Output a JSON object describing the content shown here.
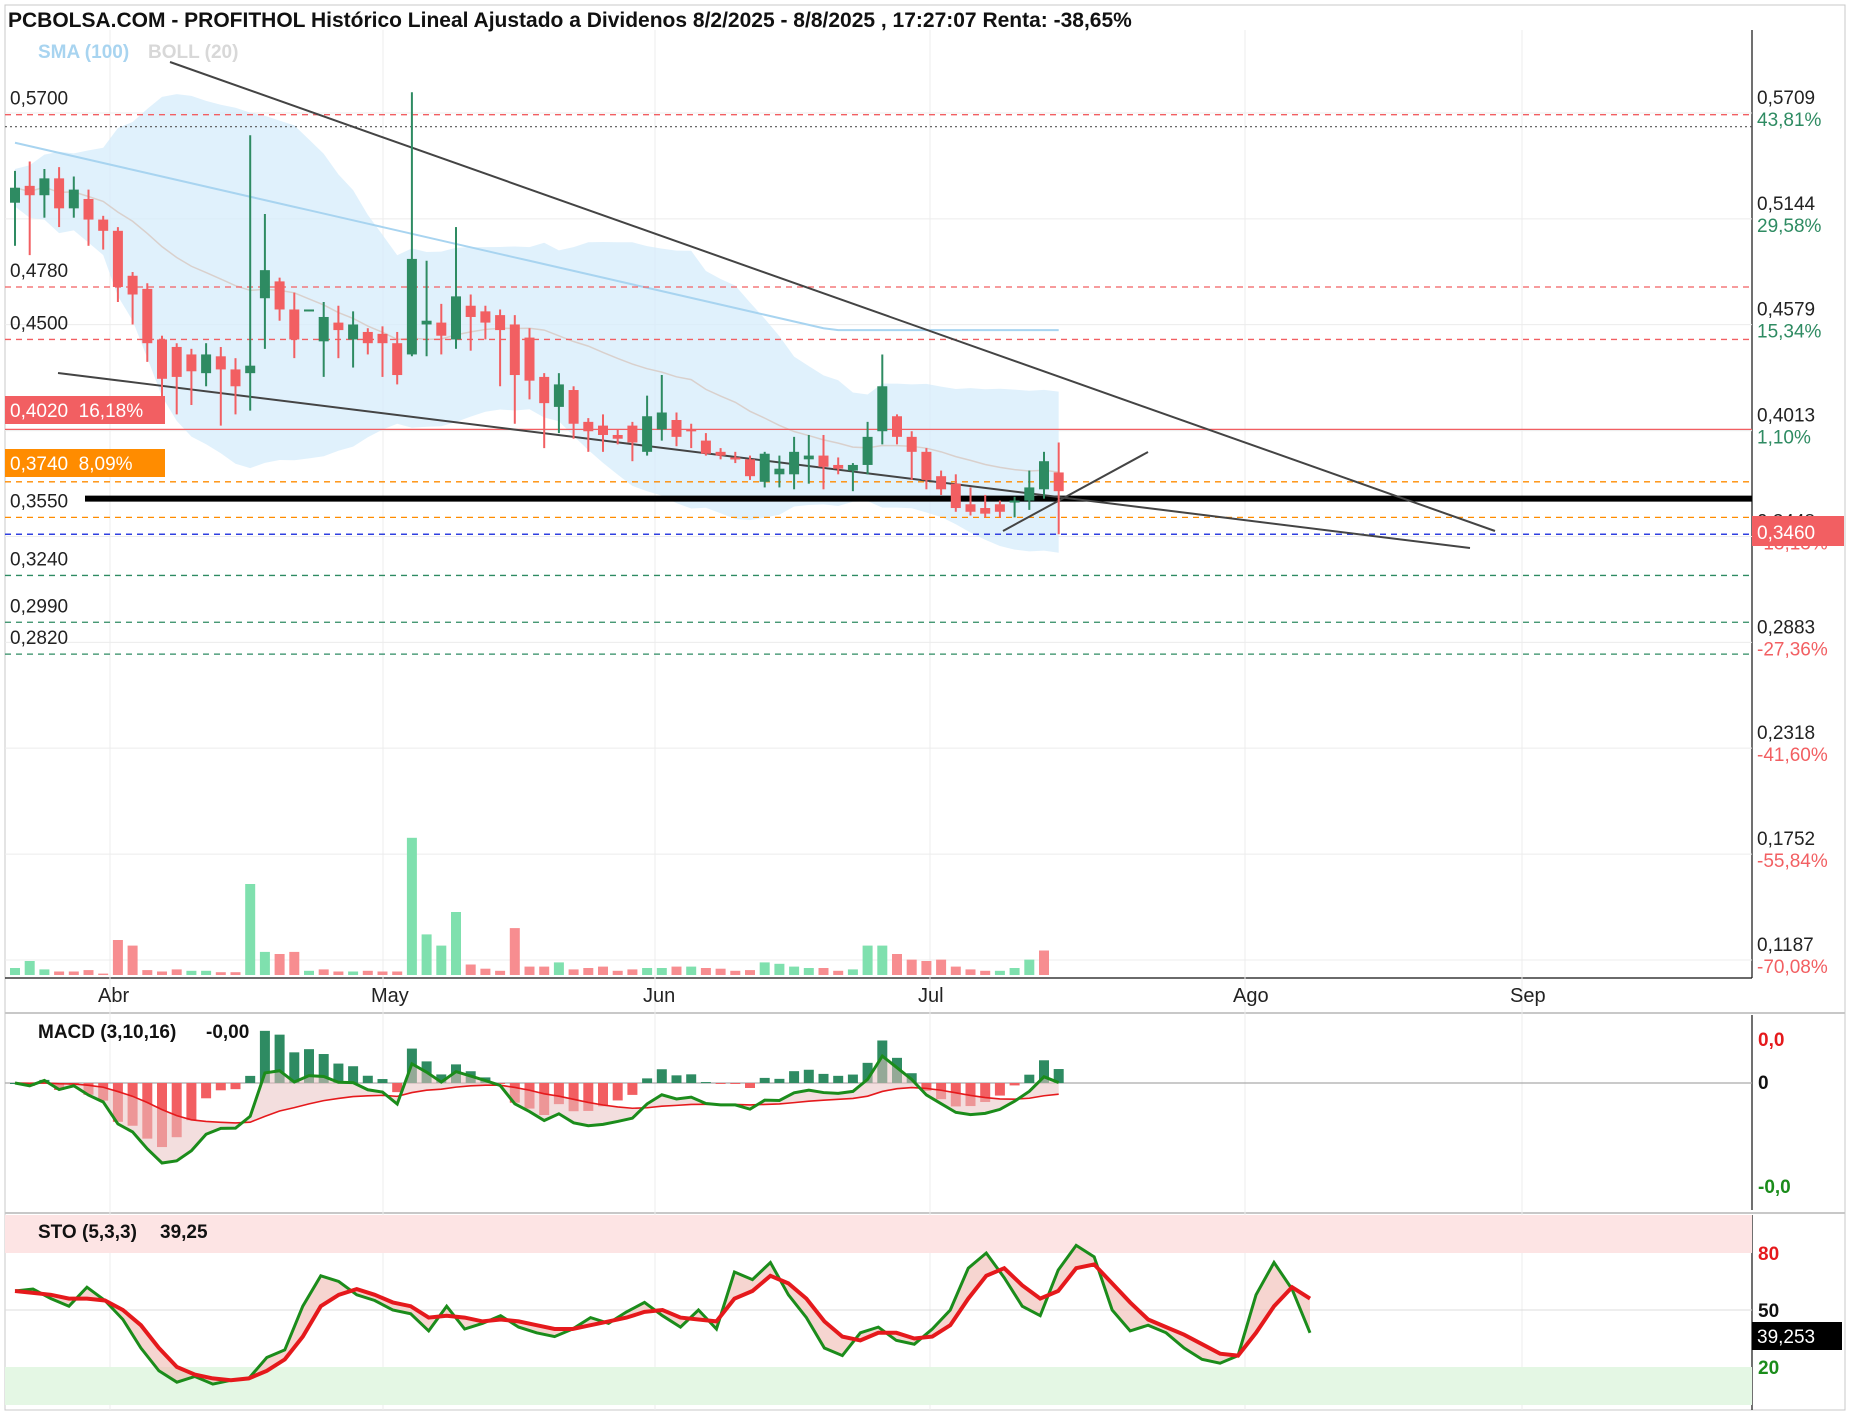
{
  "title": "PCBOLSA.COM - PROFITHOL Histórico Lineal Ajustado a Dividenos 8/2/2025 - 8/8/2025 , 17:27:07 Renta: -38,65%",
  "colors": {
    "up": "#2e8b62",
    "down": "#f25f62",
    "band": "#d6ecfb",
    "sma": "#a8d4f0",
    "vol_up": "#7fe0ae",
    "vol_down": "#f78d90",
    "macd_line": "#1b8c1b",
    "signal": "#e5191c",
    "sto_k": "#1b8c1b",
    "sto_d": "#e5191c"
  },
  "chart_data": [
    {
      "type": "candlestick",
      "legend": {
        "sma": "SMA (100)",
        "boll": "BOLL (20)"
      },
      "x_labels": [
        "Abr",
        "May",
        "Jun",
        "Jul",
        "Ago",
        "Sep"
      ],
      "right_axis": [
        {
          "price": "0,5709",
          "pct": "43,81%",
          "sign": "pos"
        },
        {
          "price": "0,5144",
          "pct": "29,58%",
          "sign": "pos"
        },
        {
          "price": "0,4579",
          "pct": "15,34%",
          "sign": "pos"
        },
        {
          "price": "0,4013",
          "pct": "1,10%",
          "sign": "pos"
        },
        {
          "price": "0,3448",
          "pct": "-13,13%",
          "sign": "neg"
        },
        {
          "price": "0,2883",
          "pct": "-27,36%",
          "sign": "neg"
        },
        {
          "price": "0,2318",
          "pct": "-41,60%",
          "sign": "neg"
        },
        {
          "price": "0,1752",
          "pct": "-55,84%",
          "sign": "neg"
        },
        {
          "price": "0,1187",
          "pct": "-70,08%",
          "sign": "neg"
        }
      ],
      "left_levels": [
        {
          "value": "0,5700",
          "style": "dash-red"
        },
        {
          "value": "0,4780",
          "style": "dash-red"
        },
        {
          "value": "0,4500",
          "style": "dash-red"
        },
        {
          "value": "0,3550",
          "style": "dash-orange"
        },
        {
          "value": "0,3240",
          "style": "dash-green"
        },
        {
          "value": "0,2990",
          "style": "dash-green"
        },
        {
          "value": "0,2820",
          "style": "dash-green"
        }
      ],
      "badges": [
        {
          "text": "0,4020  16,18%",
          "color": "#f25f62"
        },
        {
          "text": "0,3740  8,09%",
          "color": "#ff8c00"
        }
      ],
      "last_price": "0,3460",
      "candles": [
        {
          "o": 0.523,
          "h": 0.54,
          "l": 0.5,
          "c": 0.531
        },
        {
          "o": 0.532,
          "h": 0.545,
          "l": 0.495,
          "c": 0.527
        },
        {
          "o": 0.527,
          "h": 0.541,
          "l": 0.515,
          "c": 0.536
        },
        {
          "o": 0.536,
          "h": 0.542,
          "l": 0.51,
          "c": 0.52
        },
        {
          "o": 0.52,
          "h": 0.537,
          "l": 0.515,
          "c": 0.53
        },
        {
          "o": 0.525,
          "h": 0.53,
          "l": 0.5,
          "c": 0.514
        },
        {
          "o": 0.514,
          "h": 0.516,
          "l": 0.498,
          "c": 0.508
        },
        {
          "o": 0.508,
          "h": 0.51,
          "l": 0.47,
          "c": 0.478
        },
        {
          "o": 0.484,
          "h": 0.486,
          "l": 0.458,
          "c": 0.474
        },
        {
          "o": 0.477,
          "h": 0.48,
          "l": 0.438,
          "c": 0.448
        },
        {
          "o": 0.45,
          "h": 0.452,
          "l": 0.417,
          "c": 0.429
        },
        {
          "o": 0.446,
          "h": 0.448,
          "l": 0.41,
          "c": 0.43
        },
        {
          "o": 0.442,
          "h": 0.445,
          "l": 0.415,
          "c": 0.433
        },
        {
          "o": 0.432,
          "h": 0.448,
          "l": 0.425,
          "c": 0.442
        },
        {
          "o": 0.441,
          "h": 0.446,
          "l": 0.404,
          "c": 0.434
        },
        {
          "o": 0.434,
          "h": 0.44,
          "l": 0.41,
          "c": 0.425
        },
        {
          "o": 0.432,
          "h": 0.559,
          "l": 0.412,
          "c": 0.436
        },
        {
          "o": 0.472,
          "h": 0.517,
          "l": 0.445,
          "c": 0.487
        },
        {
          "o": 0.481,
          "h": 0.483,
          "l": 0.46,
          "c": 0.466
        },
        {
          "o": 0.466,
          "h": 0.475,
          "l": 0.44,
          "c": 0.45
        },
        {
          "o": 0.466,
          "h": 0.466,
          "l": 0.465,
          "c": 0.466
        },
        {
          "o": 0.449,
          "h": 0.47,
          "l": 0.43,
          "c": 0.462
        },
        {
          "o": 0.459,
          "h": 0.468,
          "l": 0.44,
          "c": 0.455
        },
        {
          "o": 0.45,
          "h": 0.465,
          "l": 0.435,
          "c": 0.458
        },
        {
          "o": 0.454,
          "h": 0.456,
          "l": 0.442,
          "c": 0.448
        },
        {
          "o": 0.453,
          "h": 0.457,
          "l": 0.43,
          "c": 0.448
        },
        {
          "o": 0.448,
          "h": 0.454,
          "l": 0.426,
          "c": 0.431
        },
        {
          "o": 0.442,
          "h": 0.582,
          "l": 0.441,
          "c": 0.493
        },
        {
          "o": 0.458,
          "h": 0.492,
          "l": 0.441,
          "c": 0.46
        },
        {
          "o": 0.459,
          "h": 0.469,
          "l": 0.442,
          "c": 0.452
        },
        {
          "o": 0.45,
          "h": 0.51,
          "l": 0.445,
          "c": 0.473
        },
        {
          "o": 0.468,
          "h": 0.474,
          "l": 0.444,
          "c": 0.462
        },
        {
          "o": 0.465,
          "h": 0.468,
          "l": 0.45,
          "c": 0.459
        },
        {
          "o": 0.463,
          "h": 0.466,
          "l": 0.425,
          "c": 0.455
        },
        {
          "o": 0.458,
          "h": 0.463,
          "l": 0.405,
          "c": 0.431
        },
        {
          "o": 0.451,
          "h": 0.456,
          "l": 0.418,
          "c": 0.428
        },
        {
          "o": 0.43,
          "h": 0.432,
          "l": 0.392,
          "c": 0.416
        },
        {
          "o": 0.414,
          "h": 0.432,
          "l": 0.4,
          "c": 0.426
        },
        {
          "o": 0.423,
          "h": 0.425,
          "l": 0.397,
          "c": 0.405
        },
        {
          "o": 0.406,
          "h": 0.408,
          "l": 0.39,
          "c": 0.401
        },
        {
          "o": 0.404,
          "h": 0.41,
          "l": 0.39,
          "c": 0.399
        },
        {
          "o": 0.399,
          "h": 0.402,
          "l": 0.394,
          "c": 0.397
        },
        {
          "o": 0.404,
          "h": 0.406,
          "l": 0.385,
          "c": 0.395
        },
        {
          "o": 0.39,
          "h": 0.42,
          "l": 0.388,
          "c": 0.409
        },
        {
          "o": 0.402,
          "h": 0.431,
          "l": 0.396,
          "c": 0.411
        },
        {
          "o": 0.407,
          "h": 0.411,
          "l": 0.393,
          "c": 0.398
        },
        {
          "o": 0.402,
          "h": 0.405,
          "l": 0.392,
          "c": 0.401
        },
        {
          "o": 0.396,
          "h": 0.4,
          "l": 0.388,
          "c": 0.389
        },
        {
          "o": 0.39,
          "h": 0.392,
          "l": 0.386,
          "c": 0.388
        },
        {
          "o": 0.387,
          "h": 0.39,
          "l": 0.384,
          "c": 0.386
        },
        {
          "o": 0.386,
          "h": 0.388,
          "l": 0.375,
          "c": 0.377
        },
        {
          "o": 0.374,
          "h": 0.39,
          "l": 0.371,
          "c": 0.389
        },
        {
          "o": 0.378,
          "h": 0.388,
          "l": 0.371,
          "c": 0.381
        },
        {
          "o": 0.378,
          "h": 0.398,
          "l": 0.37,
          "c": 0.39
        },
        {
          "o": 0.386,
          "h": 0.399,
          "l": 0.373,
          "c": 0.388
        },
        {
          "o": 0.388,
          "h": 0.399,
          "l": 0.37,
          "c": 0.382
        },
        {
          "o": 0.383,
          "h": 0.387,
          "l": 0.378,
          "c": 0.381
        },
        {
          "o": 0.38,
          "h": 0.384,
          "l": 0.369,
          "c": 0.383
        },
        {
          "o": 0.383,
          "h": 0.406,
          "l": 0.378,
          "c": 0.398
        },
        {
          "o": 0.401,
          "h": 0.442,
          "l": 0.394,
          "c": 0.425
        },
        {
          "o": 0.409,
          "h": 0.41,
          "l": 0.394,
          "c": 0.398
        },
        {
          "o": 0.398,
          "h": 0.401,
          "l": 0.375,
          "c": 0.39
        },
        {
          "o": 0.39,
          "h": 0.392,
          "l": 0.37,
          "c": 0.375
        },
        {
          "o": 0.377,
          "h": 0.38,
          "l": 0.367,
          "c": 0.37
        },
        {
          "o": 0.373,
          "h": 0.378,
          "l": 0.358,
          "c": 0.36
        },
        {
          "o": 0.362,
          "h": 0.371,
          "l": 0.356,
          "c": 0.358
        },
        {
          "o": 0.36,
          "h": 0.367,
          "l": 0.355,
          "c": 0.357
        },
        {
          "o": 0.362,
          "h": 0.364,
          "l": 0.355,
          "c": 0.358
        },
        {
          "o": 0.363,
          "h": 0.366,
          "l": 0.355,
          "c": 0.364
        },
        {
          "o": 0.364,
          "h": 0.38,
          "l": 0.359,
          "c": 0.371
        },
        {
          "o": 0.37,
          "h": 0.39,
          "l": 0.365,
          "c": 0.385
        },
        {
          "o": 0.379,
          "h": 0.395,
          "l": 0.346,
          "c": 0.369
        }
      ],
      "volumes": [
        {
          "v": 0.1,
          "up": true
        },
        {
          "v": 0.2,
          "up": true
        },
        {
          "v": 0.08,
          "up": true
        },
        {
          "v": 0.05,
          "up": false
        },
        {
          "v": 0.05,
          "up": false
        },
        {
          "v": 0.07,
          "up": false
        },
        {
          "v": 0.02,
          "up": false
        },
        {
          "v": 0.5,
          "up": false
        },
        {
          "v": 0.42,
          "up": false
        },
        {
          "v": 0.07,
          "up": false
        },
        {
          "v": 0.05,
          "up": false
        },
        {
          "v": 0.08,
          "up": false
        },
        {
          "v": 0.06,
          "up": true
        },
        {
          "v": 0.06,
          "up": true
        },
        {
          "v": 0.04,
          "up": false
        },
        {
          "v": 0.04,
          "up": false
        },
        {
          "v": 1.3,
          "up": true
        },
        {
          "v": 0.33,
          "up": true
        },
        {
          "v": 0.3,
          "up": false
        },
        {
          "v": 0.33,
          "up": false
        },
        {
          "v": 0.06,
          "up": true
        },
        {
          "v": 0.08,
          "up": false
        },
        {
          "v": 0.05,
          "up": false
        },
        {
          "v": 0.05,
          "up": true
        },
        {
          "v": 0.06,
          "up": false
        },
        {
          "v": 0.05,
          "up": false
        },
        {
          "v": 0.05,
          "up": false
        },
        {
          "v": 1.96,
          "up": true
        },
        {
          "v": 0.58,
          "up": true
        },
        {
          "v": 0.42,
          "up": true
        },
        {
          "v": 0.9,
          "up": true
        },
        {
          "v": 0.15,
          "up": false
        },
        {
          "v": 0.09,
          "up": false
        },
        {
          "v": 0.06,
          "up": false
        },
        {
          "v": 0.67,
          "up": false
        },
        {
          "v": 0.12,
          "up": false
        },
        {
          "v": 0.12,
          "up": false
        },
        {
          "v": 0.18,
          "up": true
        },
        {
          "v": 0.08,
          "up": false
        },
        {
          "v": 0.1,
          "up": false
        },
        {
          "v": 0.12,
          "up": false
        },
        {
          "v": 0.06,
          "up": false
        },
        {
          "v": 0.08,
          "up": false
        },
        {
          "v": 0.1,
          "up": true
        },
        {
          "v": 0.1,
          "up": true
        },
        {
          "v": 0.12,
          "up": false
        },
        {
          "v": 0.12,
          "up": true
        },
        {
          "v": 0.1,
          "up": false
        },
        {
          "v": 0.09,
          "up": false
        },
        {
          "v": 0.06,
          "up": false
        },
        {
          "v": 0.07,
          "up": false
        },
        {
          "v": 0.18,
          "up": true
        },
        {
          "v": 0.16,
          "up": true
        },
        {
          "v": 0.12,
          "up": true
        },
        {
          "v": 0.1,
          "up": true
        },
        {
          "v": 0.1,
          "up": false
        },
        {
          "v": 0.06,
          "up": false
        },
        {
          "v": 0.08,
          "up": true
        },
        {
          "v": 0.42,
          "up": true
        },
        {
          "v": 0.42,
          "up": true
        },
        {
          "v": 0.3,
          "up": false
        },
        {
          "v": 0.22,
          "up": false
        },
        {
          "v": 0.2,
          "up": false
        },
        {
          "v": 0.22,
          "up": false
        },
        {
          "v": 0.12,
          "up": false
        },
        {
          "v": 0.08,
          "up": false
        },
        {
          "v": 0.06,
          "up": false
        },
        {
          "v": 0.06,
          "up": true
        },
        {
          "v": 0.1,
          "up": true
        },
        {
          "v": 0.22,
          "up": true
        },
        {
          "v": 0.35,
          "up": false
        }
      ]
    },
    {
      "type": "line",
      "name": "MACD (3,10,16)",
      "value": "-0,00",
      "axis_labels": [
        "0,0",
        "0",
        "-0,0"
      ]
    },
    {
      "type": "line",
      "name": "STO (5,3,3)",
      "value": "39,25",
      "last_value": "39,253",
      "axis_labels": [
        "80",
        "50",
        "20"
      ],
      "k": [
        60,
        61,
        56,
        52,
        62,
        55,
        45,
        30,
        18,
        12,
        15,
        11,
        13,
        14,
        25,
        29,
        52,
        68,
        65,
        58,
        55,
        50,
        48,
        39,
        52,
        40,
        43,
        47,
        41,
        38,
        36,
        40,
        46,
        43,
        49,
        54,
        47,
        41,
        50,
        40,
        70,
        66,
        75,
        58,
        46,
        30,
        26,
        38,
        41,
        34,
        32,
        40,
        50,
        72,
        80,
        67,
        52,
        47,
        71,
        84,
        78,
        50,
        39,
        42,
        38,
        30,
        24,
        22,
        26,
        58,
        75,
        61,
        38
      ],
      "d": [
        60,
        59,
        58,
        56,
        56,
        55,
        50,
        42,
        30,
        20,
        16,
        14,
        13,
        14,
        18,
        24,
        36,
        52,
        58,
        61,
        58,
        54,
        52,
        46,
        47,
        46,
        44,
        45,
        44,
        42,
        40,
        40,
        42,
        44,
        46,
        49,
        50,
        46,
        45,
        44,
        56,
        60,
        68,
        64,
        56,
        44,
        36,
        34,
        38,
        38,
        35,
        36,
        42,
        56,
        68,
        72,
        63,
        56,
        60,
        72,
        74,
        64,
        54,
        45,
        41,
        37,
        32,
        27,
        26,
        38,
        52,
        62,
        56
      ]
    }
  ]
}
